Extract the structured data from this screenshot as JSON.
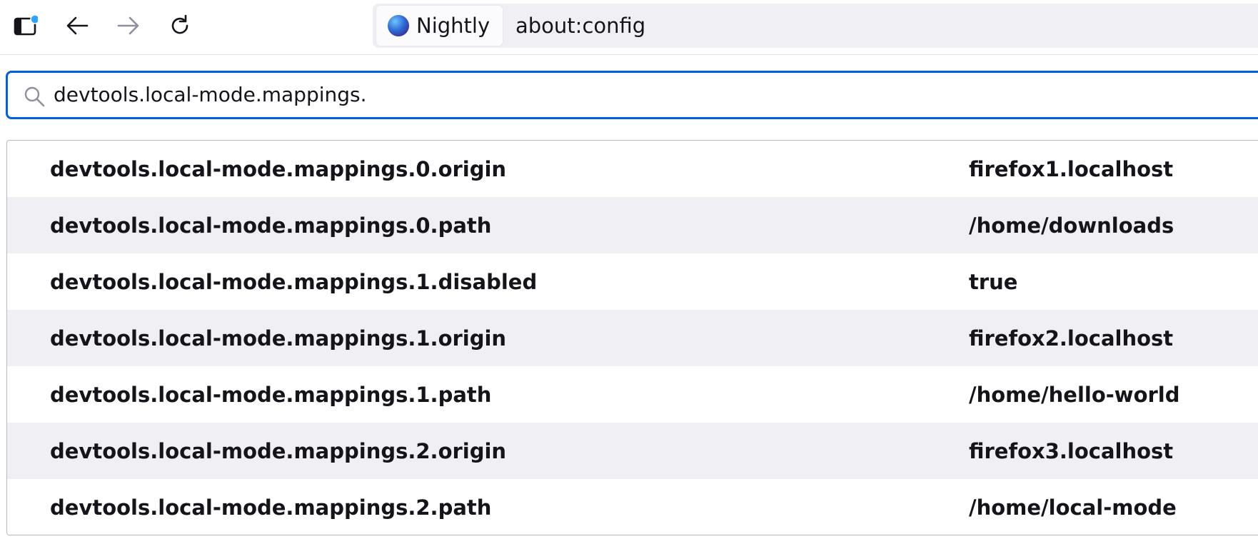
{
  "toolbar": {
    "sidebar_icon": "sidebar-icon",
    "back_icon": "arrow-left-icon",
    "forward_icon": "arrow-right-icon",
    "reload_icon": "reload-icon",
    "identity_label": "Nightly",
    "url": "about:config"
  },
  "search": {
    "icon": "search-icon",
    "value": "devtools.local-mode.mappings."
  },
  "prefs": [
    {
      "name": "devtools.local-mode.mappings.0.origin",
      "value": "firefox1.localhost"
    },
    {
      "name": "devtools.local-mode.mappings.0.path",
      "value": "/home/downloads"
    },
    {
      "name": "devtools.local-mode.mappings.1.disabled",
      "value": "true"
    },
    {
      "name": "devtools.local-mode.mappings.1.origin",
      "value": "firefox2.localhost"
    },
    {
      "name": "devtools.local-mode.mappings.1.path",
      "value": "/home/hello-world"
    },
    {
      "name": "devtools.local-mode.mappings.2.origin",
      "value": "firefox3.localhost"
    },
    {
      "name": "devtools.local-mode.mappings.2.path",
      "value": "/home/local-mode"
    }
  ],
  "colors": {
    "accent": "#0061e0",
    "sidebar_badge": "#2ea3ff",
    "stripe": "#f0f0f4"
  }
}
